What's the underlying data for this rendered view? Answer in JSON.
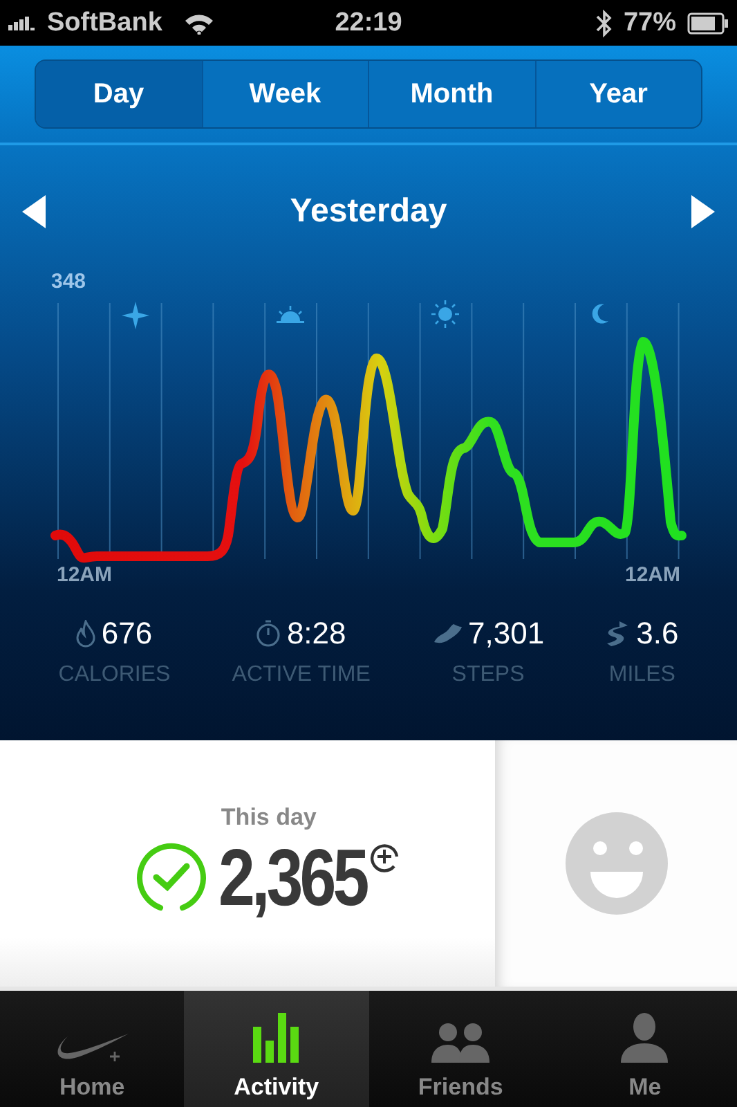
{
  "status_bar": {
    "carrier": "SoftBank",
    "time": "22:19",
    "battery": "77%"
  },
  "tabs": [
    {
      "label": "Day",
      "selected": true
    },
    {
      "label": "Week",
      "selected": false
    },
    {
      "label": "Month",
      "selected": false
    },
    {
      "label": "Year",
      "selected": false
    }
  ],
  "date_nav": {
    "title": "Yesterday"
  },
  "chart": {
    "max_label": "348",
    "start_label": "12AM",
    "end_label": "12AM"
  },
  "stats": [
    {
      "kind": "calories",
      "value": "676",
      "label": "CALORIES"
    },
    {
      "kind": "time",
      "value": "8:28",
      "label": "ACTIVE TIME"
    },
    {
      "kind": "steps",
      "value": "7,301",
      "label": "STEPS"
    },
    {
      "kind": "distance",
      "value": "3.6",
      "label": "MILES"
    }
  ],
  "summary": {
    "title": "This day",
    "value": "2,365",
    "goal_met": true
  },
  "tab_bar": [
    {
      "kind": "home",
      "label": "Home",
      "selected": false
    },
    {
      "kind": "activity",
      "label": "Activity",
      "selected": true
    },
    {
      "kind": "friends",
      "label": "Friends",
      "selected": false
    },
    {
      "kind": "me",
      "label": "Me",
      "selected": false
    }
  ]
}
